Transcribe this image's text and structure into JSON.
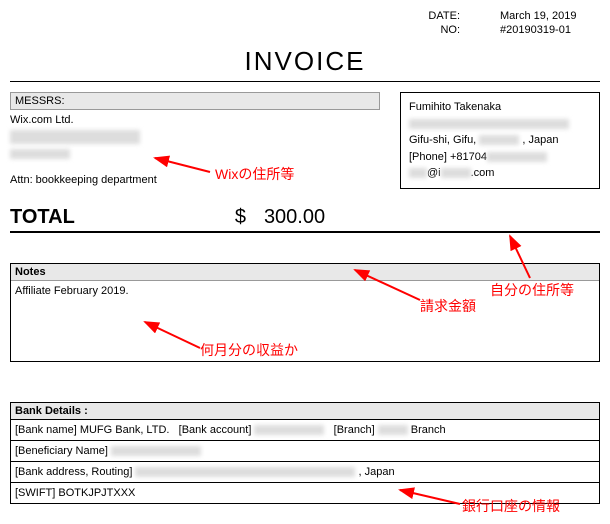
{
  "meta": {
    "date_label": "DATE:",
    "date_value": "March 19, 2019",
    "no_label": "NO:",
    "no_value": "#20190319-01"
  },
  "title": "INVOICE",
  "recipient": {
    "header": "MESSRS:",
    "name": "Wix.com Ltd.",
    "attn": "Attn: bookkeeping department"
  },
  "sender": {
    "name": "Fumihito Takenaka",
    "city_line_prefix": "Gifu-shi, Gifu,",
    "city_line_suffix": ", Japan",
    "phone_prefix": "[Phone] +81704",
    "email_prefix": "@i",
    "email_suffix": ".com"
  },
  "total": {
    "label": "TOTAL",
    "currency": "$",
    "amount": "300.00"
  },
  "notes": {
    "header": "Notes",
    "body": "Affiliate February 2019."
  },
  "bank": {
    "header": "Bank Details :",
    "row1_a": "[Bank name] MUFG Bank, LTD.",
    "row1_b": "[Bank account]",
    "row1_c": "[Branch]",
    "row1_d": "Branch",
    "row2": "[Beneficiary Name]",
    "row3_a": "[Bank address, Routing]",
    "row3_b": ", Japan",
    "row4": "[SWIFT] BOTKJPJTXXX"
  },
  "annotations": {
    "wix_address": "Wixの住所等",
    "own_address": "自分の住所等",
    "invoice_amount": "請求金額",
    "which_month": "何月分の収益か",
    "bank_info": "銀行口座の情報"
  }
}
